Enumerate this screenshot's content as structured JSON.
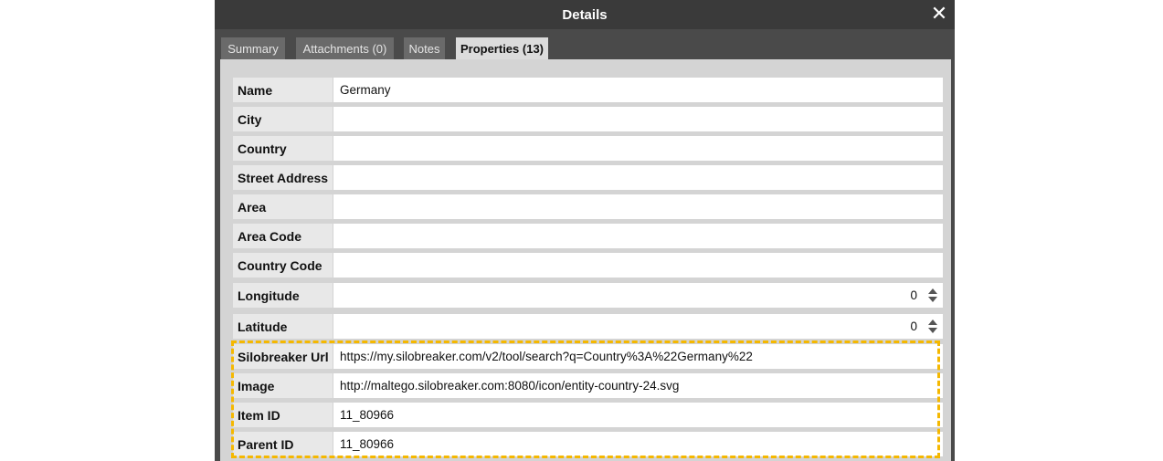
{
  "window": {
    "title": "Details",
    "close_glyph": "✕"
  },
  "tabs": [
    {
      "label": "Summary",
      "active": false
    },
    {
      "label": "Attachments (0)",
      "active": false
    },
    {
      "label": "Notes",
      "active": false
    },
    {
      "label": "Properties (13)",
      "active": true
    }
  ],
  "properties": [
    {
      "label": "Name",
      "value": "Germany"
    },
    {
      "label": "City",
      "value": ""
    },
    {
      "label": "Country",
      "value": ""
    },
    {
      "label": "Street Address",
      "value": ""
    },
    {
      "label": "Area",
      "value": ""
    },
    {
      "label": "Area Code",
      "value": ""
    },
    {
      "label": "Country Code",
      "value": ""
    },
    {
      "label": "Longitude",
      "value": "0"
    },
    {
      "label": "Latitude",
      "value": "0"
    },
    {
      "label": "Silobreaker Url",
      "value": "https://my.silobreaker.com/v2/tool/search?q=Country%3A%22Germany%22"
    },
    {
      "label": "Image",
      "value": "http://maltego.silobreaker.com:8080/icon/entity-country-24.svg"
    },
    {
      "label": "Item ID",
      "value": "11_80966"
    },
    {
      "label": "Parent ID",
      "value": "11_80966"
    }
  ],
  "colors": {
    "titlebar": "#3a3a3a",
    "active_tab": "#dcdcdc",
    "inactive_tab": "#6a6a6a",
    "highlight": "#f5b800"
  }
}
